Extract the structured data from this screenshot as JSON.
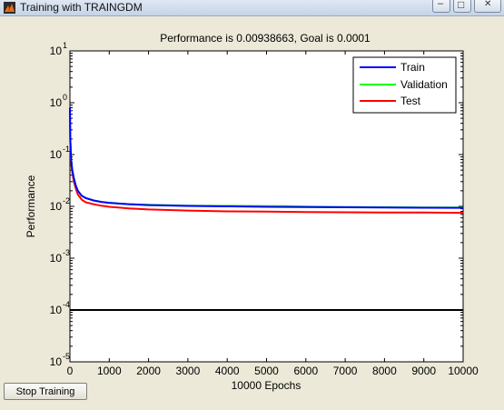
{
  "window": {
    "title": "Training with TRAINGDM",
    "minimize_glyph": "–",
    "maximize_glyph": "□",
    "close_glyph": "✕"
  },
  "stop_button": {
    "label": "Stop Training"
  },
  "chart_data": {
    "type": "line",
    "title": "Performance is 0.00938663, Goal is 0.0001",
    "xlabel": "10000 Epochs",
    "ylabel": "Performance",
    "xlim": [
      0,
      10000
    ],
    "ylim": [
      1e-05,
      10
    ],
    "yscale": "log",
    "grid": false,
    "legend_position": "top-right",
    "x_ticks": [
      0,
      1000,
      2000,
      3000,
      4000,
      5000,
      6000,
      7000,
      8000,
      9000,
      10000
    ],
    "y_tick_labels": [
      {
        "base": "10",
        "exp": "1",
        "value": 10
      },
      {
        "base": "10",
        "exp": "0",
        "value": 1
      },
      {
        "base": "10",
        "exp": "-1",
        "value": 0.1
      },
      {
        "base": "10",
        "exp": "-2",
        "value": 0.01
      },
      {
        "base": "10",
        "exp": "-3",
        "value": 0.001
      },
      {
        "base": "10",
        "exp": "-4",
        "value": 0.0001
      },
      {
        "base": "10",
        "exp": "-5",
        "value": 1e-05
      }
    ],
    "series": [
      {
        "name": "Train",
        "color": "#0000ff",
        "x": [
          0,
          10,
          30,
          60,
          100,
          150,
          200,
          300,
          400,
          600,
          800,
          1000,
          1500,
          2000,
          3000,
          4000,
          5000,
          6000,
          7000,
          8000,
          9000,
          10000
        ],
        "y": [
          0.8,
          0.2,
          0.08,
          0.05,
          0.035,
          0.025,
          0.02,
          0.016,
          0.0145,
          0.013,
          0.0122,
          0.0117,
          0.011,
          0.0106,
          0.0102,
          0.01,
          0.0098,
          0.0097,
          0.0096,
          0.0095,
          0.0094,
          0.00938663
        ]
      },
      {
        "name": "Validation",
        "color": "#00ff00",
        "x": [
          0,
          10,
          30,
          60,
          100,
          150,
          200,
          300,
          400,
          600,
          800,
          1000,
          1500,
          2000,
          3000,
          4000,
          5000,
          5500,
          6000,
          7000,
          8000,
          9000,
          10000
        ],
        "y": [
          0.8,
          0.2,
          0.08,
          0.05,
          0.035,
          0.025,
          0.02,
          0.016,
          0.0145,
          0.013,
          0.0122,
          0.0117,
          0.011,
          0.0107,
          0.0103,
          0.0102,
          0.0101,
          0.0101,
          0.0099,
          0.0097,
          0.0096,
          0.0095,
          0.0095
        ]
      },
      {
        "name": "Test",
        "color": "#ff0000",
        "x": [
          0,
          10,
          30,
          60,
          100,
          150,
          200,
          300,
          400,
          600,
          800,
          1000,
          1500,
          2000,
          3000,
          4000,
          5000,
          6000,
          7000,
          8000,
          9000,
          10000
        ],
        "y": [
          0.7,
          0.17,
          0.07,
          0.045,
          0.03,
          0.022,
          0.017,
          0.0135,
          0.012,
          0.011,
          0.0103,
          0.0098,
          0.0091,
          0.0087,
          0.0083,
          0.008,
          0.0079,
          0.0078,
          0.0077,
          0.0076,
          0.0076,
          0.0075
        ]
      }
    ],
    "goal": {
      "value": 0.0001,
      "color": "#000000"
    }
  }
}
